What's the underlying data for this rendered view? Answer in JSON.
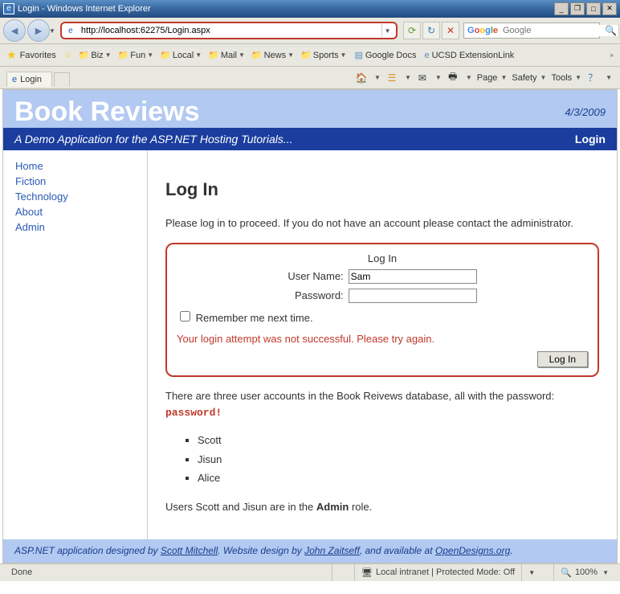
{
  "window": {
    "title": "Login - Windows Internet Explorer"
  },
  "address": {
    "url": "http://localhost:62275/Login.aspx"
  },
  "search": {
    "placeholder": "Google"
  },
  "favbar": {
    "label": "Favorites",
    "items": [
      "Biz",
      "Fun",
      "Local",
      "Mail",
      "News",
      "Sports"
    ],
    "google_docs": "Google Docs",
    "ucsd": "UCSD ExtensionLink"
  },
  "tab": {
    "label": "Login"
  },
  "menu": {
    "page": "Page",
    "safety": "Safety",
    "tools": "Tools"
  },
  "header": {
    "title": "Book Reviews",
    "date": "4/3/2009",
    "subtitle": "A Demo Application for the ASP.NET Hosting Tutorials...",
    "login": "Login"
  },
  "nav": {
    "items": [
      "Home",
      "Fiction",
      "Technology",
      "About",
      "Admin"
    ]
  },
  "page": {
    "h2": "Log In",
    "intro": "Please log in to proceed. If you do not have an account please contact the administrator.",
    "login_header": "Log In",
    "username_label": "User Name:",
    "username_value": "Sam",
    "password_label": "Password:",
    "remember": "Remember me next time.",
    "error": "Your login attempt was not successful. Please try again.",
    "login_btn": "Log In",
    "note1a": "There are three user accounts in the Book Reivews database, all with the password: ",
    "note1b": "password!",
    "accounts": [
      "Scott",
      "Jisun",
      "Alice"
    ],
    "note2a": "Users Scott and Jisun are in the ",
    "note2b": "Admin",
    "note2c": " role."
  },
  "footer": {
    "t1": "ASP.NET application designed by ",
    "a1": "Scott Mitchell",
    "t2": ". Website design by ",
    "a2": "John Zaitseff",
    "t3": ", and available at ",
    "a3": "OpenDesigns.org",
    "t4": "."
  },
  "status": {
    "done": "Done",
    "zone": "Local intranet | Protected Mode: Off",
    "zoom": "100%"
  }
}
